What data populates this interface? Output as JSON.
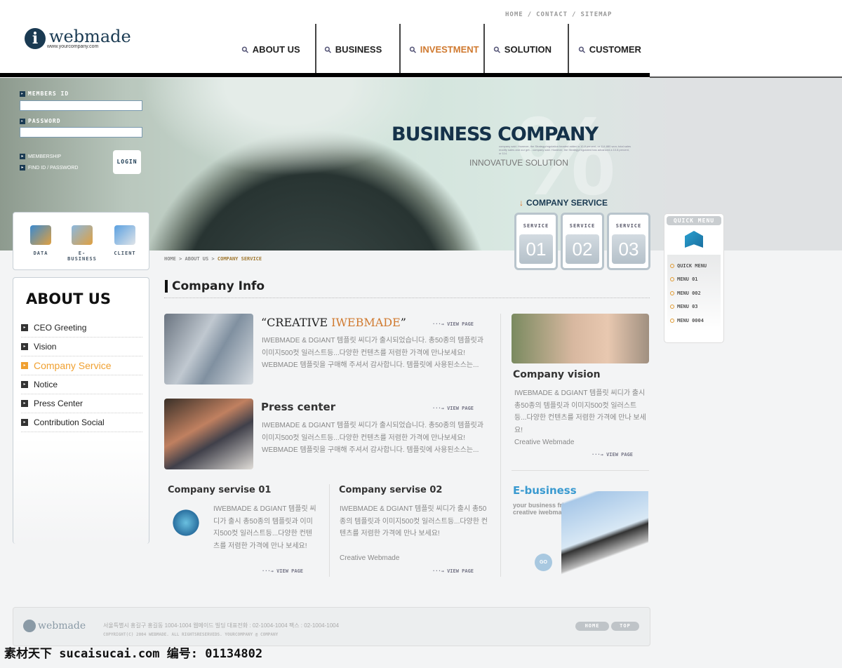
{
  "util_nav": [
    "HOME",
    "/",
    "CONTACT",
    "/",
    "SITEMAP"
  ],
  "logo": {
    "name": "webmade",
    "url": "www.yourcompany.com"
  },
  "nav": [
    {
      "label": "ABOUT US"
    },
    {
      "label": "BUSINESS"
    },
    {
      "label": "INVESTMENT",
      "active": true
    },
    {
      "label": "SOLUTION"
    },
    {
      "label": "CUSTOMER"
    }
  ],
  "login": {
    "id_label": "MEMBERS ID",
    "pw_label": "PASSWORD",
    "membership": "MEMBERSHIP",
    "find": "FIND ID / PASSWORD",
    "button": "LOGIN"
  },
  "hero": {
    "title": "BUSINESS COMPANY",
    "symbol": "%",
    "small": "company said. However, the Strategy/regulation headed added a 10.8 percent, or 114,880 won; total sales modify sales and our get... company said. However, the Strategy/regulated has advanced a 10.8 percent, or 114.",
    "subtitle": "INNOVATUVE SOLUTION"
  },
  "company_service": {
    "title": "COMPANY SERVICE",
    "items": [
      {
        "label": "SERVICE",
        "num": "01"
      },
      {
        "label": "SERVICE",
        "num": "02"
      },
      {
        "label": "SERVICE",
        "num": "03"
      }
    ]
  },
  "quick_menu": {
    "title": "QUICK MENU",
    "items": [
      "QUICK MENU",
      "MENU 01",
      "MENU 002",
      "MENU 03",
      "MENU 0004"
    ]
  },
  "icons": [
    {
      "label": "DATA",
      "icon": "books-icon"
    },
    {
      "label": "E-BUSINESS",
      "icon": "monitor-icon"
    },
    {
      "label": "CLIENT",
      "icon": "pda-icon"
    }
  ],
  "sidebar": {
    "title": "ABOUT US",
    "items": [
      "CEO Greeting",
      "Vision",
      "Company Service",
      "Notice",
      "Press Center",
      "Contribution Social"
    ],
    "active": 2
  },
  "breadcrumb": [
    "HOME",
    ">",
    "ABOUT US",
    ">",
    "COMPANY SERVICE"
  ],
  "main": {
    "heading": "Company Info",
    "view": "···→ VIEW PAGE",
    "creative": {
      "q1": "“CREATIVE ",
      "accent": "IWEBMADE",
      "q2": "”",
      "body": "IWEBMADE & DGIANT 템플릿 씨디가 출시되었습니다. 총50종의 템플릿과 이미지500컷 일러스트등...다양한 컨텐츠를 저렴한 가격에 만나보세요! WEBMADE 템플릿을 구매해 주셔서 감사합니다. 템플릿에 사용된소스는..."
    },
    "press": {
      "title": "Press center",
      "body": "IWEBMADE & DGIANT 템플릿 씨디가 출시되었습니다. 총50종의 템플릿과 이미지500컷 일러스트등...다양한 컨텐츠를 저렴한 가격에 만나보세요! WEBMADE 템플릿을 구매해 주셔서 감사합니다. 템플릿에 사용된소스는..."
    },
    "svc1": {
      "title": "Company servise 01",
      "body": "IWEBMADE & DGIANT 템플릿 씨디가 출시 총50종의 템플릿과 이미지500컷 일러스트등...다양한 컨텐츠를 저렴한 가격에 만나 보세요!"
    },
    "svc2": {
      "title": "Company servise 02",
      "body": "IWEBMADE & DGIANT 템플릿 씨디가 출시 총50종의 템플릿과 이미지500컷 일러스트등...다양한 컨텐츠를 저렴한 가격에 만나 보세요!",
      "sign": "Creative Webmade"
    },
    "vision": {
      "title": "Company vision",
      "body": "IWEBMADE & DGIANT 템플릿 씨디가 출시 총50종의 템플릿과 이미지500컷 일러스트등...다양한 컨텐츠를 저렴한 가격에 만나 보세요!",
      "sign": "Creative Webmade"
    },
    "ebiz": {
      "title": "E-business",
      "line1": "your business friend!",
      "line2": "creative iwebmade",
      "go": "GO"
    }
  },
  "footer": {
    "logo": "webmade",
    "address": "서울특별시 홍길구 홍길동 1004-1004 웹메이드 빌딩   대표전화 : 02-1004-1004   팩스 : 02-1004-1004",
    "copyright": "COPYRIGHT(c) 2004 WEBMADE. ALL RIGHTSRESERVEDS. YOURCOMPANY @ COMPANY",
    "home": "HOME",
    "top": "TOP"
  },
  "watermark": "素材天下 sucaisucai.com  编号: 01134802",
  "colors": {
    "navy": "#15324a",
    "accent": "#e07020",
    "ebiz": "#3a9ad0"
  }
}
